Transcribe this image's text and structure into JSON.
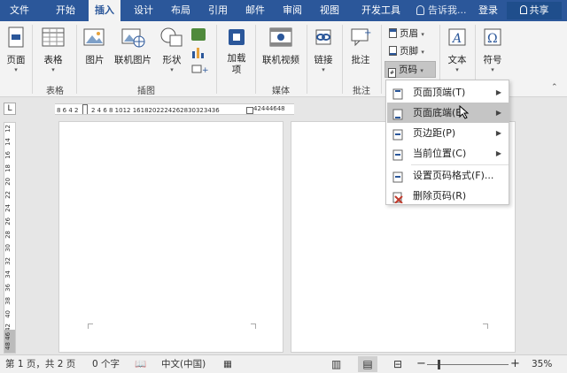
{
  "tabs": [
    "文件",
    "开始",
    "插入",
    "设计",
    "布局",
    "引用",
    "邮件",
    "审阅",
    "视图",
    "开发工具"
  ],
  "active_tab": "插入",
  "tell_me": "告诉我...",
  "login": "登录",
  "share": "共享",
  "ribbon": {
    "page_btn": "页面",
    "table_btn": "表格",
    "picture_btn": "图片",
    "online_pic_btn": "联机图片",
    "shapes_btn": "形状",
    "addins_btn": "加载项",
    "online_video_btn": "联机视频",
    "link_btn": "链接",
    "comment_btn": "批注",
    "header_btn": "页眉",
    "footer_btn": "页脚",
    "pagenum_btn": "页码",
    "text_btn": "文本",
    "symbol_btn": "符号",
    "groups": {
      "table": "表格",
      "illustrations": "插图",
      "media": "媒体",
      "comments": "批注"
    }
  },
  "ruler": {
    "corner": "L",
    "h_left": "8 6 4 2",
    "h_mid": "2 4 6 8 1012  1618202224262830323436",
    "h_right": "42444648",
    "v_ticks": [
      "12",
      "14",
      "16",
      "18",
      "20",
      "22",
      "24",
      "26",
      "28",
      "30",
      "32",
      "34",
      "36",
      "38",
      "40",
      "42",
      "48 46"
    ]
  },
  "menu": {
    "items": [
      {
        "label": "页面顶端(T)",
        "submenu": true
      },
      {
        "label": "页面底端(B)",
        "submenu": true
      },
      {
        "label": "页边距(P)",
        "submenu": true
      },
      {
        "label": "当前位置(C)",
        "submenu": true
      },
      {
        "label": "设置页码格式(F)...",
        "submenu": false
      },
      {
        "label": "删除页码(R)",
        "submenu": false
      }
    ],
    "highlighted": "页面底端(B)"
  },
  "status": {
    "pages": "第 1 页，共 2 页",
    "words": "0 个字",
    "lang": "中文(中国)",
    "zoom": "35%"
  },
  "colors": {
    "brand": "#2b579a",
    "menu_highlight": "#c5c5c5"
  }
}
